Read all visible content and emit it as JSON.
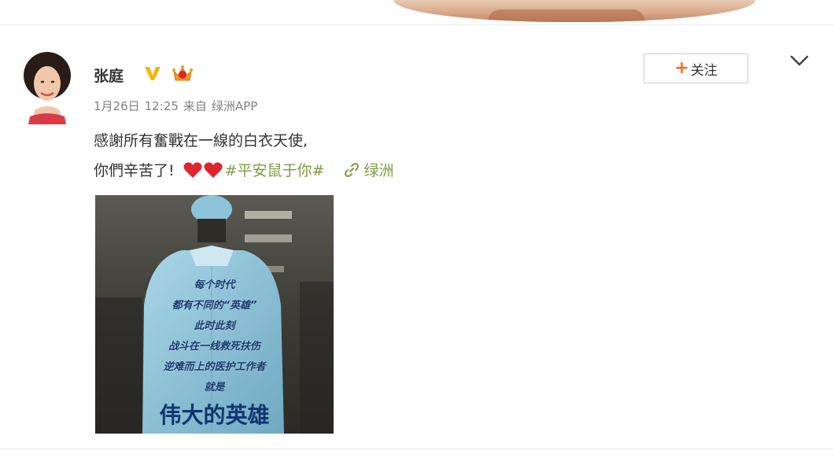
{
  "post": {
    "author": "张庭",
    "date": "1月26日",
    "time": "12:25",
    "source_prefix": "来自",
    "source": "绿洲APP",
    "text_line1": "感謝所有奮戰在一線的白衣天使,",
    "text_line2": "你們辛苦了!",
    "hashtag": "#平安鼠于你#",
    "location_link": "绿洲"
  },
  "follow_button": {
    "label": "关注"
  },
  "image_text": {
    "lines": [
      "每个时代",
      "都有不同的“英雄”",
      "此时此刻",
      "战斗在一线救死扶伤",
      "逆难而上的医护工作者",
      "就是"
    ],
    "big": "伟大的英雄"
  },
  "colors": {
    "hashtag": "#7e9a46",
    "follow_plus": "#f46c1d",
    "meta": "#808080",
    "heart": "#e0242b",
    "verified": "#f7b500"
  },
  "icons": [
    "verified-icon",
    "crown-icon",
    "heart-icon",
    "link-icon",
    "chevron-down-icon",
    "plus-icon"
  ]
}
